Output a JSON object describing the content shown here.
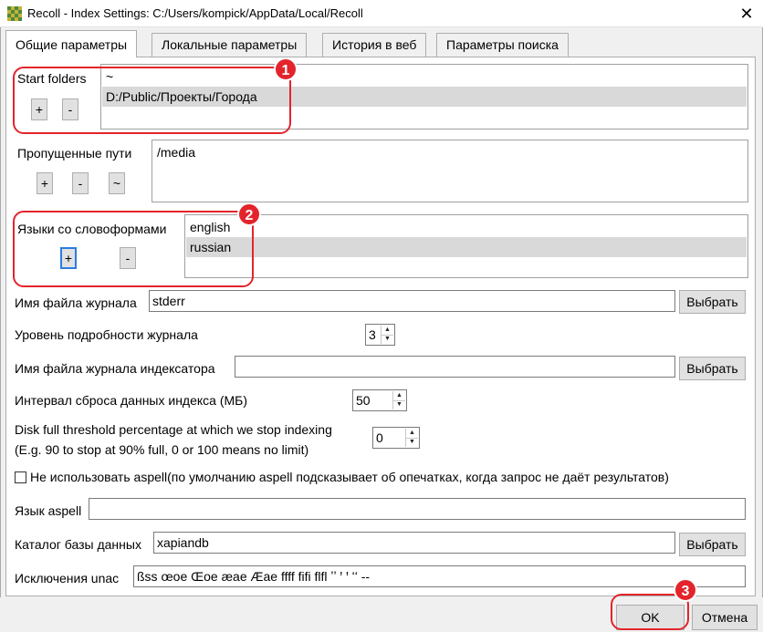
{
  "window": {
    "title": "Recoll - Index Settings: C:/Users/kompick/AppData/Local/Recoll",
    "close_glyph": "✕"
  },
  "tabs": [
    {
      "label": "Общие параметры",
      "active": true
    },
    {
      "label": "Локальные параметры",
      "active": false
    },
    {
      "label": "История в веб",
      "active": false
    },
    {
      "label": "Параметры поиска",
      "active": false
    }
  ],
  "start_folders": {
    "label": "Start folders",
    "items": [
      "~",
      "D:/Public/Проекты/Города"
    ],
    "add_label": "+",
    "remove_label": "-"
  },
  "skipped_paths": {
    "label": "Пропущенные пути",
    "items": [
      "/media"
    ],
    "add_label": "+",
    "remove_label": "-",
    "home_label": "~"
  },
  "stem_languages": {
    "label": "Языки со словоформами",
    "items": [
      "english",
      "russian"
    ],
    "add_label": "+",
    "remove_label": "-"
  },
  "log_file": {
    "label": "Имя файла журнала",
    "value": "stderr",
    "browse_label": "Выбрать"
  },
  "log_level": {
    "label": "Уровень подробности журнала",
    "value": "3"
  },
  "indexer_log": {
    "label": "Имя файла журнала индексатора",
    "value": "",
    "browse_label": "Выбрать"
  },
  "flush_interval": {
    "label": "Интервал сброса данных индекса (МБ)",
    "value": "50"
  },
  "disk_full": {
    "label_line1": "Disk full threshold percentage at which we stop indexing",
    "label_line2": "(E.g. 90 to stop at 90% full, 0 or 100 means no limit)",
    "value": "0"
  },
  "aspell": {
    "checkbox_label": "Не использовать aspell(по умолчанию aspell подсказывает об опечатках, когда запрос не даёт результатов)",
    "checked": false,
    "lang_label": "Язык aspell",
    "lang_value": ""
  },
  "db_dir": {
    "label": "Каталог базы данных",
    "value": "xapiandb",
    "browse_label": "Выбрать"
  },
  "unac": {
    "label": "Исключения unac",
    "value": "ßss œoe Œoe æae Æae ffff fifi flfl ʼʼ ꞌ ꞌ ʻʻ --"
  },
  "footer": {
    "ok_label": "OK",
    "cancel_label": "Отмена"
  },
  "annotations": [
    "1",
    "2",
    "3"
  ],
  "colors": {
    "annotation_red": "#e3242b",
    "selection": "#d9d9d9",
    "focus_blue": "#2d7be0"
  }
}
